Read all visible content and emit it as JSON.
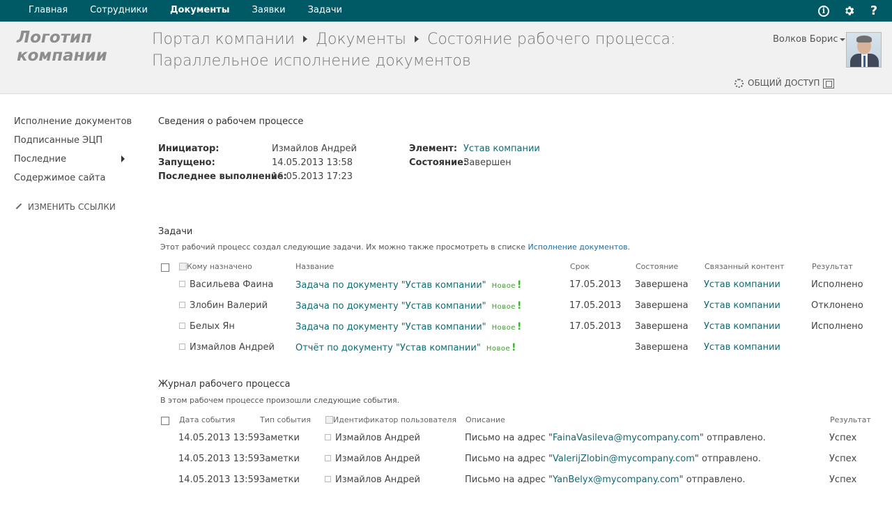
{
  "suitebar": {
    "nav": [
      "Главная",
      "Сотрудники",
      "Документы",
      "Заявки",
      "Задачи"
    ],
    "active_index": 2,
    "color": "#005a65",
    "icons": [
      "info-icon",
      "gear-icon",
      "help-icon"
    ]
  },
  "header": {
    "logo_line1": "Логотип",
    "logo_line2": "компании",
    "breadcrumb": [
      "Портал компании",
      "Документы",
      "Состояние рабочего процесса: Параллельное исполнение документов"
    ],
    "user_name": "Волков Борис",
    "share_label": "ОБЩИЙ ДОСТУП"
  },
  "leftnav": {
    "items": [
      "Исполнение документов",
      "Подписанные ЭЦП",
      "Последние",
      "Содержимое сайта"
    ],
    "edit_links": "ИЗМЕНИТЬ ССЫЛКИ"
  },
  "workflow": {
    "title": "Сведения о рабочем процессе",
    "initiator_label": "Инициатор:",
    "initiator_value": "Измайлов Андрей",
    "started_label": "Запущено:",
    "started_value": "14.05.2013 13:58",
    "last_run_label": "Последнее выполнение:",
    "last_run_value": "16.05.2013 17:23",
    "element_label": "Элемент:",
    "element_value": "Устав компании",
    "state_label": "Состояние:",
    "state_value": "Завершен"
  },
  "tasks": {
    "title": "Задачи",
    "desc_prefix": "Этот рабочий процесс создал следующие задачи. Их можно также просмотреть в списке",
    "desc_link": "Исполнение документов",
    "desc_suffix": ".",
    "columns": [
      "Кому назначено",
      "Название",
      "Срок",
      "Состояние",
      "Связанный контент",
      "Результат"
    ],
    "new_label": "Новое",
    "rows": [
      {
        "assignee": "Васильева Фаина",
        "name": "Задача по документу \"Устав компании\"",
        "due": "17.05.2013",
        "state": "Завершена",
        "content": "Устав компании",
        "result": "Исполнено"
      },
      {
        "assignee": "Злобин Валерий",
        "name": "Задача по документу \"Устав компании\"",
        "due": "17.05.2013",
        "state": "Завершена",
        "content": "Устав компании",
        "result": "Отклонено"
      },
      {
        "assignee": "Белых Ян",
        "name": "Задача по документу \"Устав компании\"",
        "due": "17.05.2013",
        "state": "Завершена",
        "content": "Устав компании",
        "result": "Исполнено"
      },
      {
        "assignee": "Измайлов Андрей",
        "name": "Отчёт по документу \"Устав компании\"",
        "due": "",
        "state": "Завершена",
        "content": "Устав компании",
        "result": ""
      }
    ]
  },
  "log": {
    "title": "Журнал рабочего процесса",
    "desc": "В этом рабочем процессе произошли следующие события.",
    "columns": [
      "Дата события",
      "Тип события",
      "Идентификатор пользователя",
      "Описание",
      "Результат"
    ],
    "rows": [
      {
        "date": "14.05.2013 13:59",
        "type": "Заметки",
        "user": "Измайлов Андрей",
        "desc_prefix": "Письмо на адрес \"",
        "email": "FainaVasileva@mycompany.com",
        "desc_suffix": "\" отправлено.",
        "result": "Успех"
      },
      {
        "date": "14.05.2013 13:59",
        "type": "Заметки",
        "user": "Измайлов Андрей",
        "desc_prefix": "Письмо на адрес \"",
        "email": "ValerijZlobin@mycompany.com",
        "desc_suffix": "\" отправлено.",
        "result": "Успех"
      },
      {
        "date": "14.05.2013 13:59",
        "type": "Заметки",
        "user": "Измайлов Андрей",
        "desc_prefix": "Письмо на адрес \"",
        "email": "YanBelyx@mycompany.com",
        "desc_suffix": "\" отправлено.",
        "result": "Успех"
      }
    ]
  }
}
